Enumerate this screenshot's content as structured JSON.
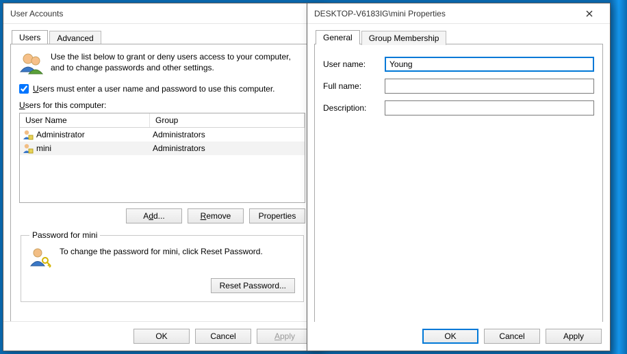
{
  "ua": {
    "title": "User Accounts",
    "tabs": {
      "users": "Users",
      "advanced": "Advanced"
    },
    "intro": "Use the list below to grant or deny users access to your computer, and to change passwords and other settings.",
    "mustSignIn_pre": "Users must enter a user name and password to use this computer.",
    "listLabel_pre": "Users for this computer:",
    "columns": {
      "user": "User Name",
      "group": "Group"
    },
    "rows": [
      {
        "user": "Administrator",
        "group": "Administrators"
      },
      {
        "user": "mini",
        "group": "Administrators"
      }
    ],
    "buttons": {
      "add": "Add...",
      "remove": "Remove",
      "properties": "Properties"
    },
    "pwGroupTitle": "Password for mini",
    "pwText": "To change the password for mini, click Reset Password.",
    "resetPw": "Reset Password...",
    "ok": "OK",
    "cancel": "Cancel",
    "apply": "Apply"
  },
  "props": {
    "title": "DESKTOP-V6183IG\\mini Properties",
    "tabs": {
      "general": "General",
      "group": "Group Membership"
    },
    "labels": {
      "user": "User name:",
      "full": "Full name:",
      "desc": "Description:"
    },
    "values": {
      "user": "Young",
      "full": "",
      "desc": ""
    },
    "ok": "OK",
    "cancel": "Cancel",
    "apply": "Apply"
  },
  "underlineLetters": {
    "U": "U",
    "d": "d",
    "R": "R",
    "A": "A"
  }
}
